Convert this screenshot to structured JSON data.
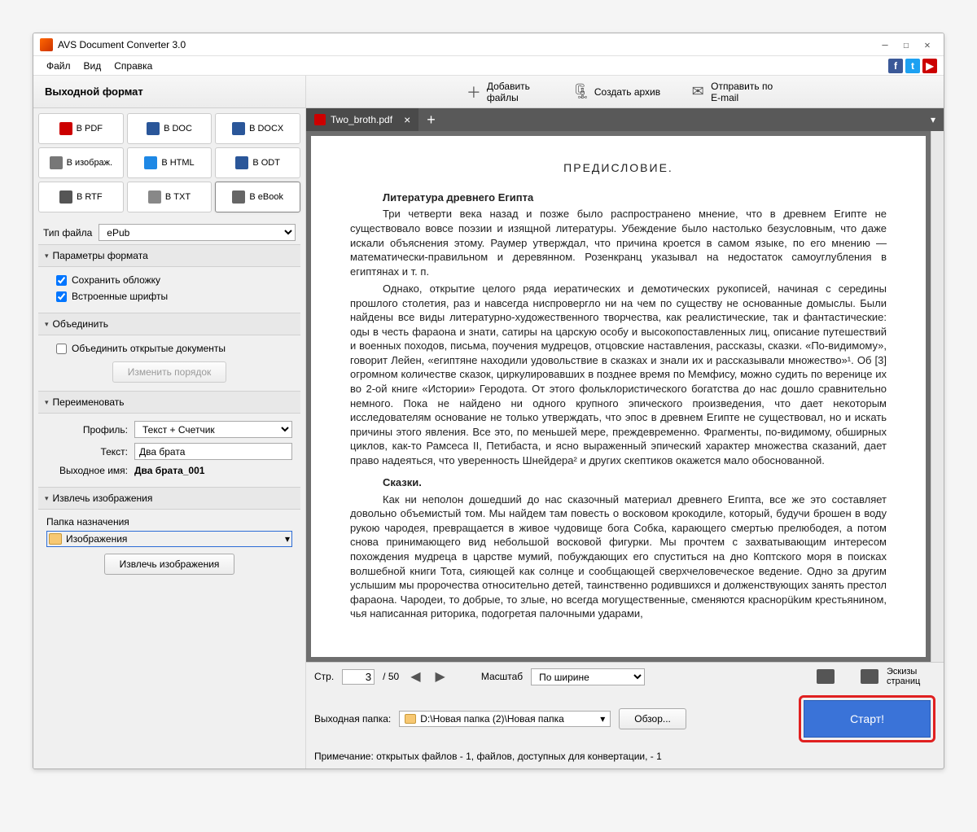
{
  "window": {
    "title": "AVS Document Converter 3.0"
  },
  "menu": {
    "file": "Файл",
    "view": "Вид",
    "help": "Справка"
  },
  "header": {
    "output_format": "Выходной формат",
    "add_files": "Добавить файлы",
    "create_archive": "Создать архив",
    "send_email": "Отправить по E-mail"
  },
  "formats": {
    "pdf": "В PDF",
    "doc": "В DOC",
    "docx": "В DOCX",
    "image": "В изображ.",
    "html": "В HTML",
    "odt": "В ODT",
    "rtf": "В RTF",
    "txt": "В TXT",
    "ebook": "В eBook"
  },
  "filetype": {
    "label": "Тип файла",
    "value": "ePub"
  },
  "sections": {
    "format_params": "Параметры формата",
    "merge": "Объединить",
    "rename": "Переименовать",
    "extract_images": "Извлечь изображения"
  },
  "format_opts": {
    "save_cover": "Сохранить обложку",
    "embed_fonts": "Встроенные шрифты"
  },
  "merge": {
    "merge_open": "Объединить открытые документы",
    "change_order": "Изменить порядок"
  },
  "rename": {
    "profile_lbl": "Профиль:",
    "profile_val": "Текст + Счетчик",
    "text_lbl": "Текст:",
    "text_val": "Два брата",
    "output_name_lbl": "Выходное имя:",
    "output_name_val": "Два брата_001"
  },
  "extract": {
    "dest_label": "Папка назначения",
    "dest_val": "Изображения",
    "btn": "Извлечь изображения"
  },
  "tab": {
    "filename": "Two_broth.pdf"
  },
  "doc": {
    "heading": "ПРЕДИСЛОВИЕ.",
    "sub1": "Литература древнего Египта",
    "p1": "Три четверти века назад и позже было распространено мнение, что в древнем Египте не существовало вовсе поэзии и изящной литературы. Убеждение было настолько безусловным, что даже искали объяснения этому. Раумер утверждал, что причина кроется в самом языке, по его мнению — математически-правильном и деревянном. Розенкранц указывал на недостаток самоуглубления в египтянах и т. п.",
    "p2": "Однако, открытие целого ряда иератических и демотических рукописей, начиная с середины прошлого столетия, раз и навсегда ниспровергло ни на чем по существу не основанные домыслы. Были найдены все виды литературно-художественного творчества, как реалистические, так и фантастические: оды в честь фараона и знати, сатиры на царскую особу и высокопоставленных лиц, описание путешествий и военных походов, письма, поучения мудрецов, отцовские наставления, рассказы, сказки. «По-видимому», говорит Лейен, «египтяне находили удовольствие в сказках и знали их и рассказывали множество»¹. Об [3] огромном количестве сказок, циркулировавших в позднее время по Мемфису, можно судить по веренице их во 2-ой книге «Истории» Геродота. От этого фольклористического богатства до нас дошло сравнительно немного. Пока не найдено ни одного крупного эпического произведения, что дает некоторым исследователям основание не только утверждать, что эпос в древнем Египте не существовал, но и искать причины этого явления. Все это, по меньшей мере, преждевременно. Фрагменты, по-видимому, обширных циклов, как-то Рамсеса II, Петибаста, и ясно выраженный эпический характер множества сказаний, дает право надеяться, что уверенность Шнейдера² и других скептиков окажется мало обоснованной.",
    "sub2": "Сказки.",
    "p3": "Как ни неполон дошедший до нас сказочный материал древнего Египта, все же это составляет довольно объемистый том. Мы найдем там повесть о восковом крокодиле, который, будучи брошен в воду рукою чародея, превращается в живое чудовище бога Собка, карающего смертью прелюбодея, а потом снова принимающего вид небольшой восковой фигурки. Мы прочтем с захватывающим интересом похождения мудреца в царстве мумий, побуждающих его спуститься на дно Коптского моря в поисках волшебной книги Тота, сияющей как солнце и сообщающей сверхчеловеческое ведение. Одно за другим услышим мы пророчества относительно детей, таинственно родившихся и долженствующих занять престол фараона. Чародеи, то добрые, то злые, но всегда могущественные, сменяются краснорükим крестьянином, чья написанная риторика, подогретая палочными ударами,"
  },
  "pager": {
    "page_lbl": "Стр.",
    "page_val": "3",
    "page_total": "/ 50",
    "zoom_lbl": "Масштаб",
    "zoom_val": "По ширине",
    "thumbs": "Эскизы страниц"
  },
  "output": {
    "folder_lbl": "Выходная папка:",
    "folder_val": "D:\\Новая папка (2)\\Новая папка",
    "browse": "Обзор...",
    "start": "Старт!",
    "note": "Примечание: открытых файлов - 1, файлов, доступных для конвертации, - 1"
  }
}
